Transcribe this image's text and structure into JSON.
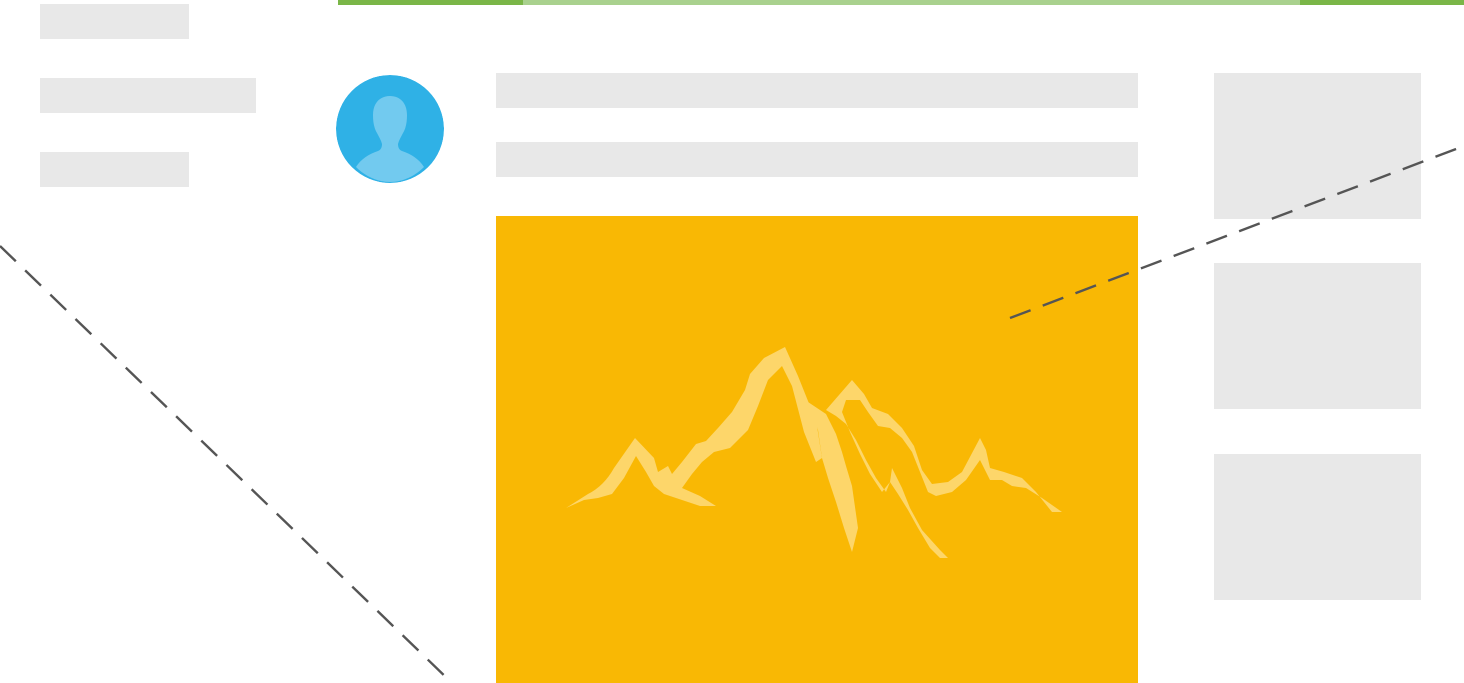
{
  "progress": {
    "value": 0.69,
    "track_color": "#a9d18e",
    "fill_color": "#7ab648"
  },
  "colors": {
    "skeleton": "#e8e8e8",
    "avatar_bg": "#2fb1e6",
    "avatar_figure": "#72caef",
    "image_bg": "#f9b804",
    "mountain": "#fdd66a",
    "dash_line": "#555555"
  },
  "icons": {
    "avatar": "person-silhouette-icon",
    "image": "mountain-image-icon"
  }
}
